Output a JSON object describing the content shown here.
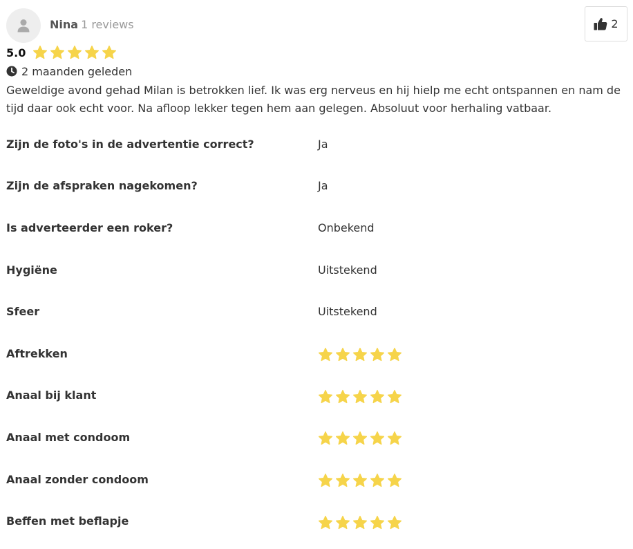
{
  "review": {
    "author_name": "Nina",
    "author_reviews": "1 reviews",
    "likes": "2",
    "score": "5.0",
    "stars": 5,
    "date": "2 maanden geleden",
    "text": "Geweldige avond gehad Milan is betrokken lief. Ik was erg nerveus en hij hielp me echt ontspannen en nam de tijd daar ook echt voor. Na afloop lekker tegen hem aan gelegen. Absoluut voor herhaling vatbaar."
  },
  "details": [
    {
      "label": "Zijn de foto's in de advertentie correct?",
      "value": "Ja"
    },
    {
      "label": "Zijn de afspraken nagekomen?",
      "value": "Ja"
    },
    {
      "label": "Is adverteerder een roker?",
      "value": "Onbekend"
    },
    {
      "label": "Hygiëne",
      "value": "Uitstekend"
    },
    {
      "label": "Sfeer",
      "value": "Uitstekend"
    },
    {
      "label": "Aftrekken",
      "stars": 5
    },
    {
      "label": "Anaal bij klant",
      "stars": 5
    },
    {
      "label": "Anaal met condoom",
      "stars": 5
    },
    {
      "label": "Anaal zonder condoom",
      "stars": 5
    },
    {
      "label": "Beffen met beflapje",
      "stars": 5
    }
  ],
  "colors": {
    "star": "#F6D44A",
    "label": "#333333",
    "muted": "#999999",
    "avatar_bg": "#EEEEEE",
    "avatar_icon": "#AAAAAA"
  },
  "icons": {
    "avatar": "user-icon",
    "like": "thumbs-up-icon",
    "date": "clock-icon",
    "rating": "star-icon"
  }
}
